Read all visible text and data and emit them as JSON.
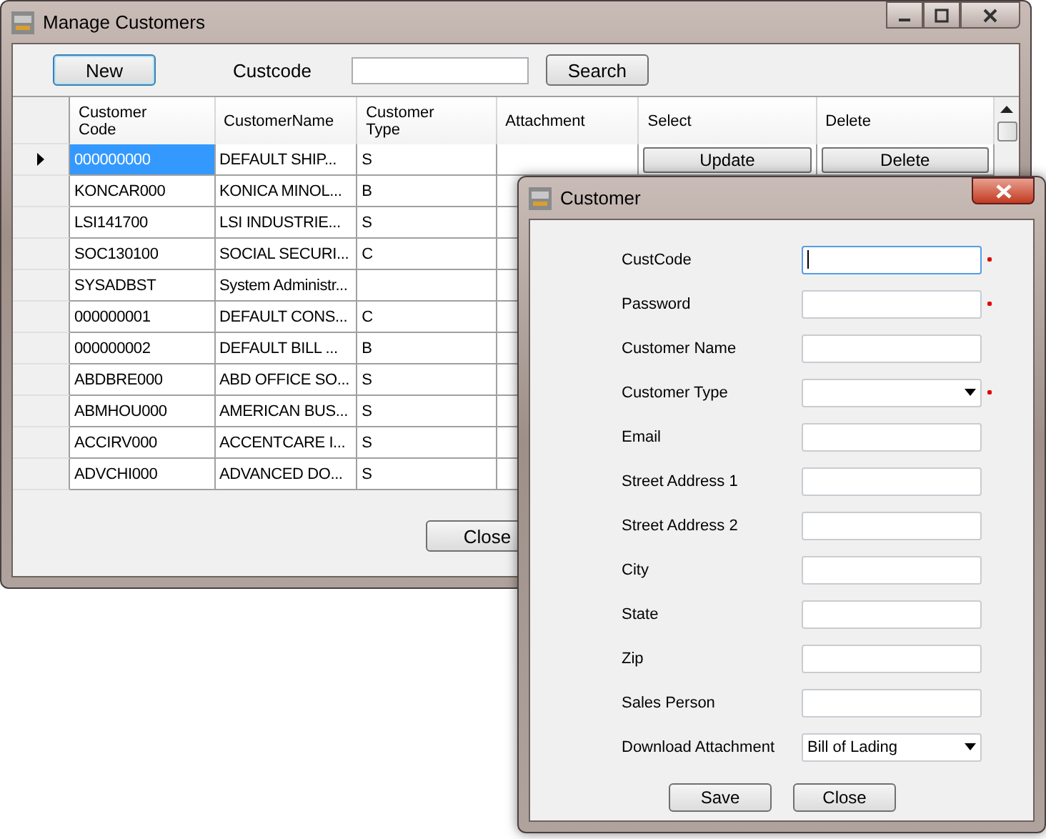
{
  "main_window": {
    "title": "Manage Customers",
    "toolbar": {
      "new_button": "New",
      "custcode_label": "Custcode",
      "search_button": "Search"
    },
    "grid": {
      "columns": [
        "Customer\nCode",
        "CustomerName",
        "Customer\nType",
        "Attachment",
        "Select",
        "Delete"
      ],
      "rows": [
        {
          "code": "000000000",
          "name": "DEFAULT SHIP...",
          "type": "S",
          "current": true,
          "selected": true,
          "select_button": "Update",
          "delete_button": "Delete"
        },
        {
          "code": "KONCAR000",
          "name": "KONICA MINOL...",
          "type": "B",
          "current": false,
          "selected": false
        },
        {
          "code": "LSI141700",
          "name": "LSI INDUSTRIE...",
          "type": "S",
          "current": false,
          "selected": false
        },
        {
          "code": "SOC130100",
          "name": "SOCIAL SECURI...",
          "type": "C",
          "current": false,
          "selected": false
        },
        {
          "code": "SYSADBST",
          "name": "System Administr...",
          "current": false,
          "selected": false
        },
        {
          "code": "000000001",
          "name": "DEFAULT CONS...",
          "type": "C",
          "current": false,
          "selected": false
        },
        {
          "code": "000000002",
          "name": "DEFAULT BILL ...",
          "type": "B",
          "current": false,
          "selected": false
        },
        {
          "code": "ABDBRE000",
          "name": "ABD OFFICE SO...",
          "type": "S",
          "current": false,
          "selected": false
        },
        {
          "code": "ABMHOU000",
          "name": "AMERICAN BUS...",
          "type": "S",
          "current": false,
          "selected": false
        },
        {
          "code": "ACCIRV000",
          "name": "ACCENTCARE I...",
          "type": "S",
          "current": false,
          "selected": false
        },
        {
          "code": "ADVCHI000",
          "name": "ADVANCED DO...",
          "type": "S",
          "current": false,
          "selected": false
        }
      ]
    },
    "close_button": "Close"
  },
  "dialog": {
    "title": "Customer",
    "fields": [
      {
        "label": "CustCode",
        "kind": "text",
        "required": true,
        "focused": true
      },
      {
        "label": "Password",
        "kind": "text",
        "required": true,
        "focused": false
      },
      {
        "label": "Customer Name",
        "kind": "text",
        "required": false,
        "focused": false
      },
      {
        "label": "Customer Type",
        "kind": "dropdown",
        "required": true,
        "focused": false
      },
      {
        "label": "Email",
        "kind": "text",
        "required": false,
        "focused": false
      },
      {
        "label": "Street Address 1",
        "kind": "text",
        "required": false,
        "focused": false
      },
      {
        "label": "Street Address 2",
        "kind": "text",
        "required": false,
        "focused": false
      },
      {
        "label": "City",
        "kind": "text",
        "required": false,
        "focused": false
      },
      {
        "label": "State",
        "kind": "text",
        "required": false,
        "focused": false
      },
      {
        "label": "Zip",
        "kind": "text",
        "required": false,
        "focused": false
      },
      {
        "label": "Sales Person",
        "kind": "text",
        "required": false,
        "focused": false
      },
      {
        "label": "Download Attachment",
        "kind": "dropdown",
        "required": false,
        "focused": false,
        "value": "Bill of Lading"
      }
    ],
    "save_button": "Save",
    "close_button": "Close"
  }
}
